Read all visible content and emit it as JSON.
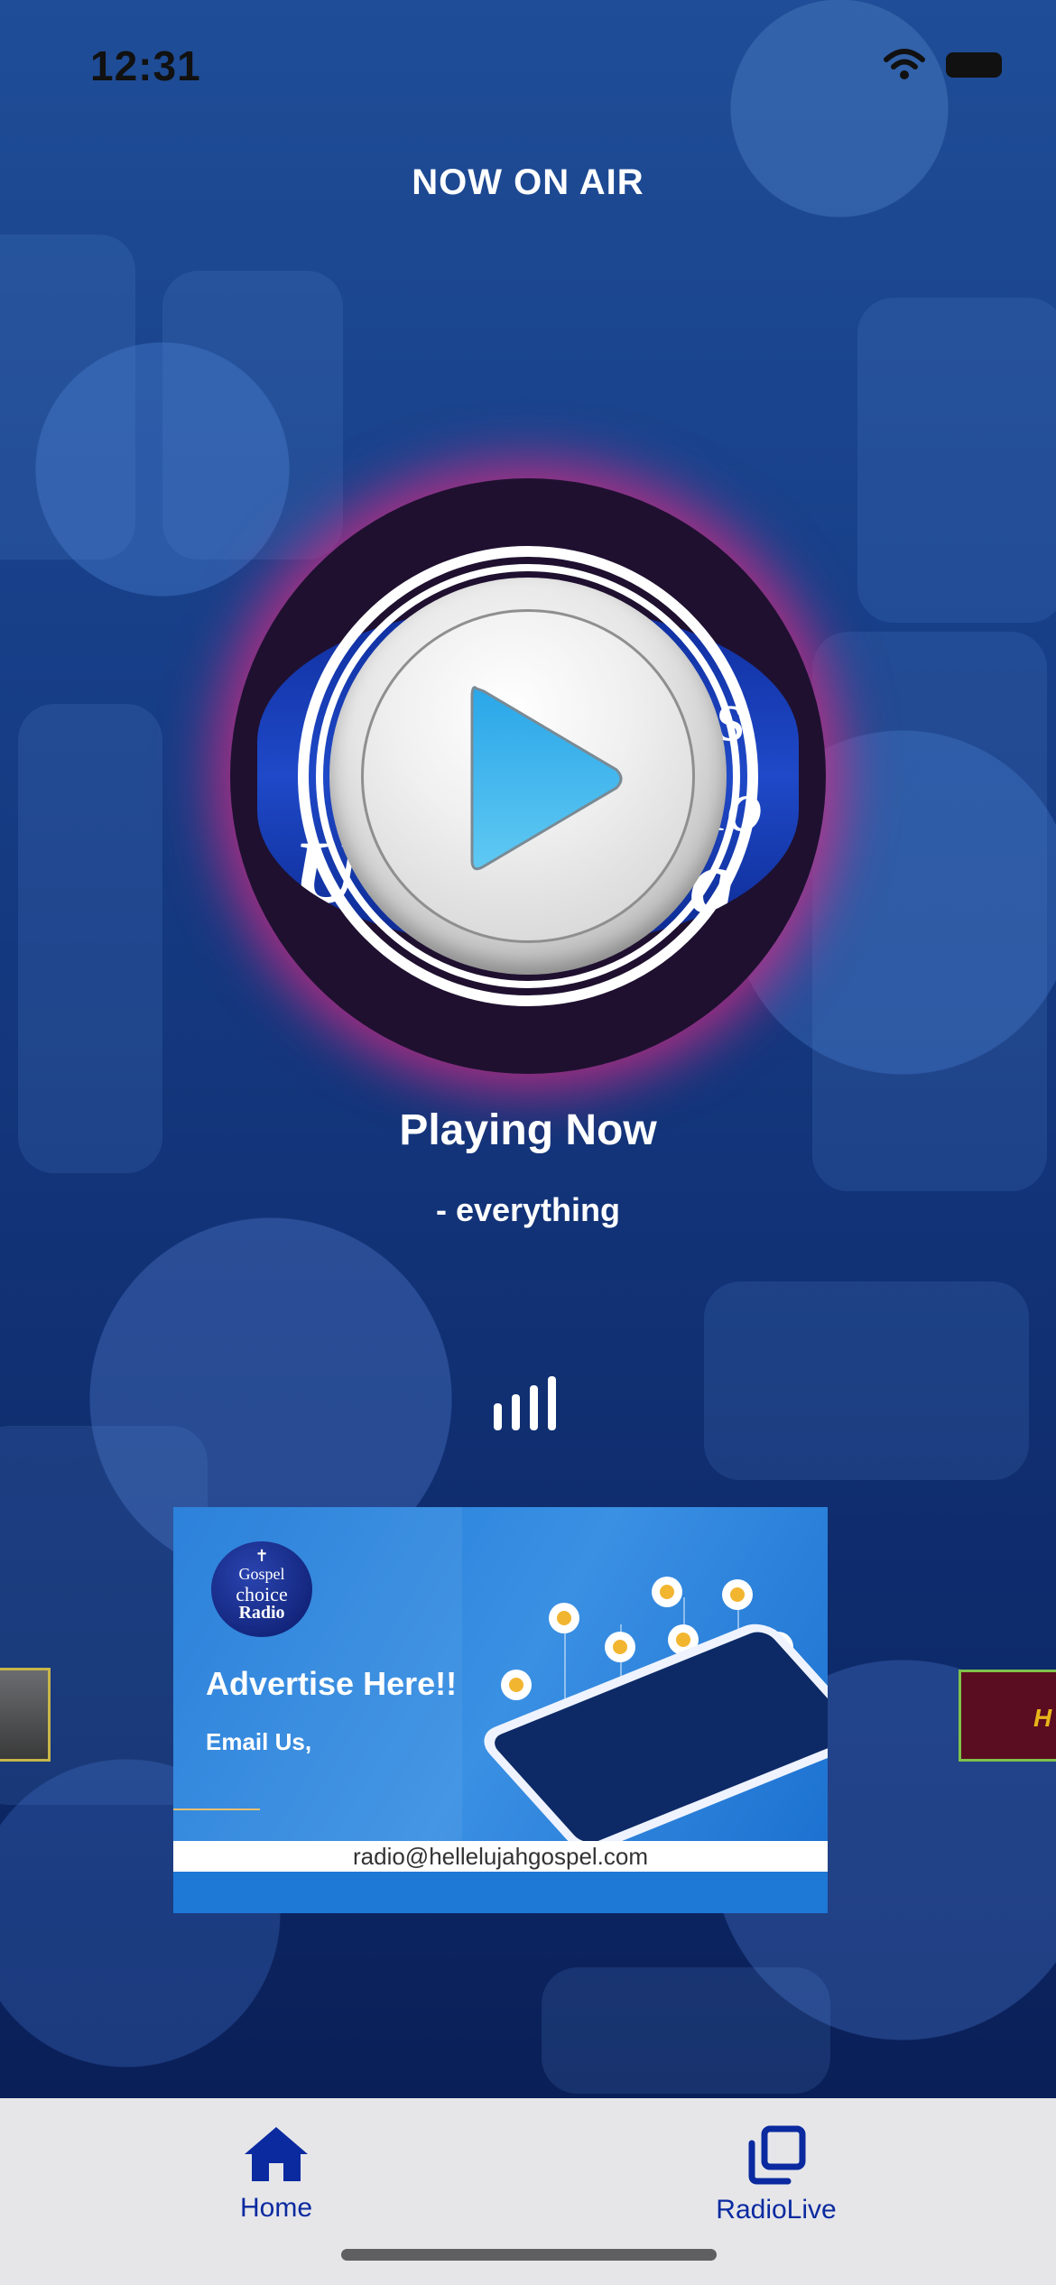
{
  "status_bar": {
    "time": "12:31"
  },
  "header": {
    "title": "NOW ON AIR"
  },
  "player": {
    "playing_label": "Playing Now",
    "track": "- everything"
  },
  "ad_banner": {
    "logo_lines": [
      "Gospel",
      "choice",
      "Radio"
    ],
    "headline": "Advertise Here!!",
    "subline": "Email Us,",
    "email": "radio@hellelujahgospel.com"
  },
  "side_thumbs": {
    "right_text": "H"
  },
  "tabs": [
    {
      "label": "Home",
      "icon": "home-icon",
      "active": true
    },
    {
      "label": "RadioLive",
      "icon": "stacked-squares-icon",
      "active": false
    }
  ],
  "colors": {
    "accent": "#0b2aa0",
    "glow": "#e62882",
    "tabbar": "#e6e6e9"
  }
}
